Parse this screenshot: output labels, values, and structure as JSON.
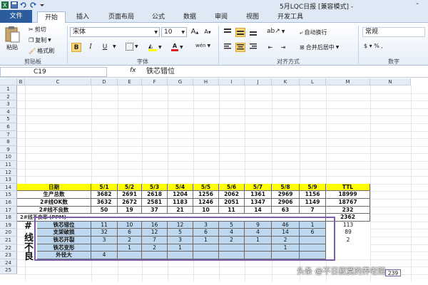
{
  "window": {
    "title": "5月LQC日报  [兼容模式] -",
    "minimize": "-"
  },
  "tabs": [
    "文件",
    "开始",
    "插入",
    "页面布局",
    "公式",
    "数据",
    "审阅",
    "视图",
    "开发工具"
  ],
  "clipboard": {
    "paste": "粘贴",
    "cut": "剪切",
    "copy": "复制",
    "format_painter": "格式刷",
    "group": "剪贴板"
  },
  "font": {
    "name": "宋体",
    "size": "10",
    "grow": "A",
    "shrink": "A",
    "bold": "B",
    "italic": "I",
    "underline": "U",
    "font_color": "A",
    "phonetic": "wén",
    "group": "字体"
  },
  "alignment": {
    "wrap": "自动换行",
    "merge": "合并后居中",
    "group": "对齐方式"
  },
  "number": {
    "format": "常规",
    "group": "数字"
  },
  "formula_bar": {
    "name_box": "C19",
    "fx": "fx",
    "content": "铁芯错位"
  },
  "columns": [
    "B",
    "C",
    "D",
    "E",
    "F",
    "G",
    "H",
    "I",
    "J",
    "K",
    "L",
    "M",
    "N"
  ],
  "rows": [
    "1",
    "2",
    "3",
    "4",
    "5",
    "6",
    "7",
    "8",
    "9",
    "10",
    "11",
    "12",
    "13",
    "14",
    "15",
    "16",
    "17",
    "18",
    "19",
    "20",
    "21",
    "22",
    "23",
    "24",
    "25"
  ],
  "table": {
    "header": [
      "日期",
      "5/1",
      "5/2",
      "5/3",
      "5/4",
      "5/5",
      "5/6",
      "5/7",
      "5/8",
      "5/9",
      "TTL"
    ],
    "summary_rows": [
      {
        "label": "生产总数",
        "values": [
          "3682",
          "2691",
          "2618",
          "1204",
          "1256",
          "2062",
          "1361",
          "2969",
          "1156",
          "18999"
        ]
      },
      {
        "label": "2#线OK数",
        "values": [
          "3632",
          "2672",
          "2581",
          "1183",
          "1246",
          "2051",
          "1347",
          "2906",
          "1149",
          "18767"
        ]
      },
      {
        "label": "2#线不良数",
        "values": [
          "50",
          "19",
          "37",
          "21",
          "10",
          "11",
          "14",
          "63",
          "7",
          "232"
        ]
      }
    ],
    "row18_label": "2#线不良率  (PPM)",
    "row18_ttl": "2362",
    "side_labels": [
      "#",
      "线",
      "不",
      "良"
    ],
    "defect_rows": [
      {
        "label": "铁芯错位",
        "values": [
          "11",
          "10",
          "16",
          "12",
          "3",
          "5",
          "9",
          "46",
          "1"
        ],
        "ttl": "113"
      },
      {
        "label": "支架破损",
        "values": [
          "32",
          "6",
          "12",
          "5",
          "6",
          "4",
          "4",
          "14",
          "6"
        ],
        "ttl": "89"
      },
      {
        "label": "铁芯开裂",
        "values": [
          "3",
          "2",
          "7",
          "3",
          "1",
          "2",
          "1",
          "2",
          ""
        ],
        "ttl": "2"
      },
      {
        "label": "铁芯变形",
        "values": [
          "",
          "1",
          "2",
          "1",
          "",
          "",
          "",
          "1",
          ""
        ],
        "ttl": ""
      },
      {
        "label": "外径大",
        "values": [
          "4",
          "",
          "",
          "",
          "",
          "",
          "",
          "",
          ""
        ],
        "ttl": ""
      }
    ],
    "footer_value": "239"
  },
  "watermark": "头条 @不日寂寞的养老院"
}
